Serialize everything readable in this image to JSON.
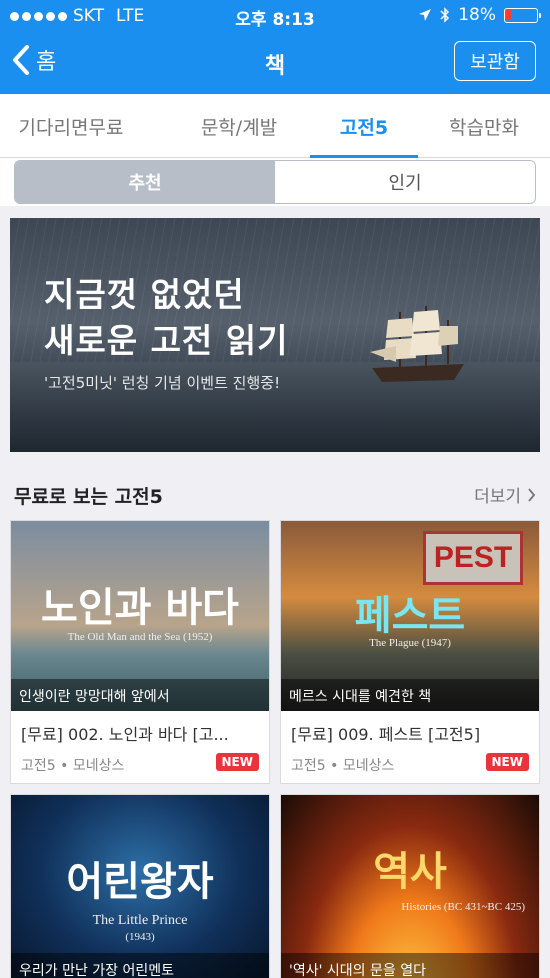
{
  "status_bar": {
    "carrier": "SKT",
    "network": "LTE",
    "time": "오후 8:13",
    "battery": "18%",
    "battery_level": 0.18
  },
  "nav": {
    "back_label": "홈",
    "title": "책",
    "right_button": "보관함"
  },
  "category_tabs": [
    {
      "label": "기다리면무료",
      "active": false
    },
    {
      "label": "문학/계발",
      "active": false
    },
    {
      "label": "고전5",
      "active": true
    },
    {
      "label": "학습만화",
      "active": false
    }
  ],
  "segments": [
    {
      "label": "추천",
      "active": true
    },
    {
      "label": "인기",
      "active": false
    }
  ],
  "banner": {
    "line1": "지금껏 없었던",
    "line2": "새로운 고전 읽기",
    "subtitle": "'고전5미닛' 런칭 기념 이벤트 진행중!"
  },
  "section": {
    "title": "무료로 보는 고전5",
    "more_label": "더보기"
  },
  "books": [
    {
      "cover_title": "노인과 바다",
      "cover_subtitle": "The Old Man and the Sea (1952)",
      "caption": "인생이란 망망대해 앞에서",
      "name": "[무료] 002. 노인과 바다 [고...",
      "publisher": "고전5 • 모네상스",
      "badge": "NEW"
    },
    {
      "cover_title": "페스트",
      "cover_subtitle": "The Plague (1947)",
      "cover_sign": "PEST",
      "caption": "메르스 시대를 예견한 책",
      "name": "[무료] 009. 페스트 [고전5]",
      "publisher": "고전5 • 모네상스",
      "badge": "NEW"
    },
    {
      "cover_title": "어린왕자",
      "cover_subtitle": "The Little Prince",
      "cover_year": "(1943)",
      "caption": "우리가 만난 가장 어린멘토"
    },
    {
      "cover_title": "역사",
      "cover_subtitle": "Histories (BC 431~BC 425)",
      "caption": "'역사' 시대의 문을 열다"
    }
  ],
  "colors": {
    "accent": "#1a8ff0",
    "new_badge": "#e8353b"
  }
}
